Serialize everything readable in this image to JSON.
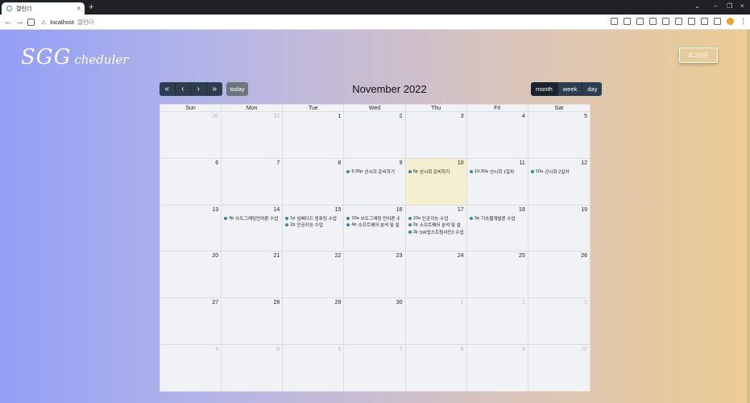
{
  "browser": {
    "tab_title": "캘린더",
    "tab_close": "×",
    "new_tab": "+",
    "window_controls": [
      "⌄",
      "–",
      "❐",
      "×"
    ],
    "nav": {
      "back": "←",
      "forward": "→"
    },
    "warning": "⚠",
    "url_host": "localhost",
    "url_path": "캘린더",
    "menu": "⋮"
  },
  "header": {
    "brand_big": "SGG",
    "brand_small": "cheduler",
    "logout_label": "로그아웃"
  },
  "calendar": {
    "prev_year": "«",
    "prev": "‹",
    "next": "›",
    "next_year": "»",
    "today_label": "today",
    "title": "November 2022",
    "views": {
      "month": "month",
      "week": "week",
      "day": "day"
    },
    "active_view": "month",
    "weekdays": [
      "Sun",
      "Mon",
      "Tue",
      "Wed",
      "Thu",
      "Fri",
      "Sat"
    ],
    "weeks": [
      [
        {
          "num": "30",
          "other": true,
          "events": []
        },
        {
          "num": "31",
          "other": true,
          "events": []
        },
        {
          "num": "1",
          "events": []
        },
        {
          "num": "2",
          "events": []
        },
        {
          "num": "3",
          "events": []
        },
        {
          "num": "4",
          "events": []
        },
        {
          "num": "5",
          "events": []
        }
      ],
      [
        {
          "num": "6",
          "events": []
        },
        {
          "num": "7",
          "events": []
        },
        {
          "num": "8",
          "events": []
        },
        {
          "num": "9",
          "events": [
            {
              "time": "6:30p",
              "title": "선시회 준비하기"
            }
          ]
        },
        {
          "num": "10",
          "today": true,
          "events": [
            {
              "time": "6p",
              "title": "선시회 준비하기"
            }
          ]
        },
        {
          "num": "11",
          "events": [
            {
              "time": "10:30a",
              "title": "선시회 1일차"
            }
          ]
        },
        {
          "num": "12",
          "events": [
            {
              "time": "10a",
              "title": "선시회 2일차"
            }
          ]
        }
      ],
      [
        {
          "num": "13",
          "events": []
        },
        {
          "num": "14",
          "events": [
            {
              "time": "4p",
              "title": "쓰도그래밍언어론 수업"
            }
          ]
        },
        {
          "num": "15",
          "events": [
            {
              "time": "1p",
              "title": "임베디드 컴퓨팅 수업"
            },
            {
              "time": "2p",
              "title": "인공지능 수업"
            }
          ]
        },
        {
          "num": "16",
          "events": [
            {
              "time": "10a",
              "title": "쓰도그래밍 언어론 수"
            },
            {
              "time": "4p",
              "title": "소프트웨어 분석 및 설"
            }
          ]
        },
        {
          "num": "17",
          "events": [
            {
              "time": "10a",
              "title": "인공지능 수업"
            },
            {
              "time": "2p",
              "title": "소프트웨어 분석 및 설"
            },
            {
              "time": "3p",
              "title": "SW업스트림사인2 수업"
            }
          ]
        },
        {
          "num": "18",
          "events": [
            {
              "time": "3p",
              "title": "기초웹개발론 수업"
            }
          ]
        },
        {
          "num": "19",
          "events": []
        }
      ],
      [
        {
          "num": "20",
          "events": []
        },
        {
          "num": "21",
          "events": []
        },
        {
          "num": "22",
          "events": []
        },
        {
          "num": "23",
          "events": []
        },
        {
          "num": "24",
          "events": []
        },
        {
          "num": "25",
          "events": []
        },
        {
          "num": "26",
          "events": []
        }
      ],
      [
        {
          "num": "27",
          "events": []
        },
        {
          "num": "28",
          "events": []
        },
        {
          "num": "29",
          "events": []
        },
        {
          "num": "30",
          "events": []
        },
        {
          "num": "1",
          "other": true,
          "events": []
        },
        {
          "num": "2",
          "other": true,
          "events": []
        },
        {
          "num": "3",
          "other": true,
          "events": []
        }
      ],
      [
        {
          "num": "4",
          "other": true,
          "events": []
        },
        {
          "num": "5",
          "other": true,
          "events": []
        },
        {
          "num": "6",
          "other": true,
          "events": []
        },
        {
          "num": "7",
          "other": true,
          "events": []
        },
        {
          "num": "8",
          "other": true,
          "events": []
        },
        {
          "num": "9",
          "other": true,
          "events": []
        },
        {
          "num": "10",
          "other": true,
          "events": []
        }
      ]
    ]
  },
  "colors": {
    "event_dot": "#3a87ad",
    "today_bg": "#f5efd2",
    "toolbar_btn": "#2c3e50"
  }
}
